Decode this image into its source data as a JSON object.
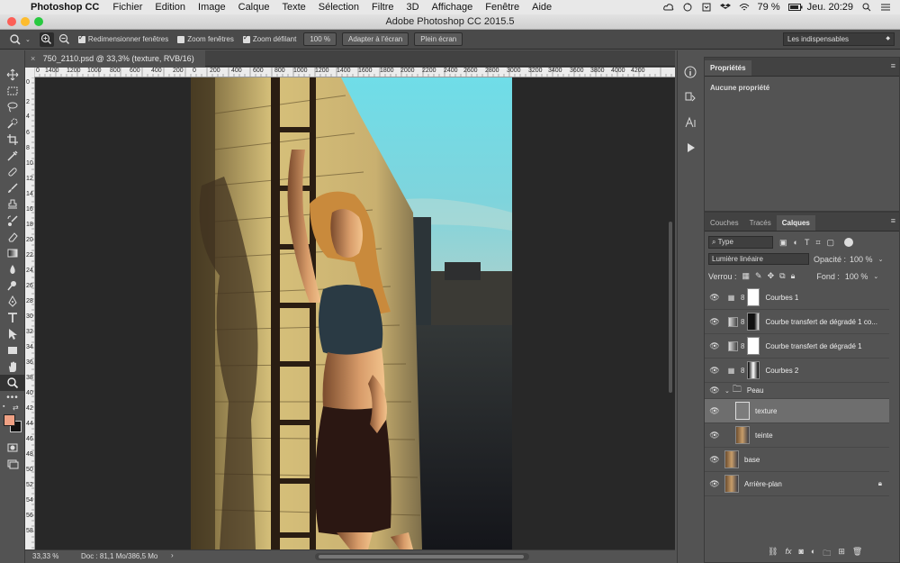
{
  "menubar": {
    "app": "Photoshop CC",
    "items": [
      "Fichier",
      "Edition",
      "Image",
      "Calque",
      "Texte",
      "Sélection",
      "Filtre",
      "3D",
      "Affichage",
      "Fenêtre",
      "Aide"
    ],
    "battery": "79 %",
    "clock": "Jeu. 20:29"
  },
  "window": {
    "title": "Adobe Photoshop CC 2015.5"
  },
  "options": {
    "resize_windows": "Redimensionner fenêtres",
    "zoom_windows": "Zoom fenêtres",
    "scrubby_zoom": "Zoom défilant",
    "zoom_value": "100 %",
    "fit_screen": "Adapter à l'écran",
    "full_screen": "Plein écran",
    "workspace": "Les indispensables"
  },
  "document": {
    "tab_title": "750_2110.psd @ 33,3% (texture, RVB/16)",
    "h_ruler": [
      "0",
      "1400",
      "1200",
      "1000",
      "800",
      "600",
      "400",
      "200",
      "0",
      "200",
      "400",
      "600",
      "800",
      "1000",
      "1200",
      "1400",
      "1600",
      "1800",
      "2000",
      "2200",
      "2400",
      "2600",
      "2800",
      "3000",
      "3200",
      "3400",
      "3600",
      "3800",
      "4000",
      "4200"
    ],
    "v_ruler": [
      "0",
      "2",
      "4",
      "6",
      "8",
      "10",
      "12",
      "14",
      "16",
      "18",
      "20",
      "22",
      "24",
      "26",
      "28",
      "30",
      "32",
      "34",
      "36",
      "38",
      "40",
      "42",
      "44",
      "46",
      "48",
      "50",
      "52",
      "54",
      "56",
      "58"
    ]
  },
  "status": {
    "zoom": "33,33 %",
    "doc": "Doc : 81,1 Mo/386,5 Mo"
  },
  "properties": {
    "tab": "Propriétés",
    "empty": "Aucune propriété"
  },
  "layers": {
    "tabs": [
      "Couches",
      "Tracés",
      "Calques"
    ],
    "filter": "Type",
    "blend_mode": "Lumière linéaire",
    "opacity_label": "Opacité :",
    "opacity": "100 %",
    "lock_label": "Verrou :",
    "fill_label": "Fond :",
    "fill": "100 %",
    "items": [
      {
        "name": "Courbes 1"
      },
      {
        "name": "Courbe transfert de dégradé 1 co..."
      },
      {
        "name": "Courbe transfert de dégradé 1"
      },
      {
        "name": "Courbes 2"
      },
      {
        "name": "Peau"
      },
      {
        "name": "texture"
      },
      {
        "name": "teinte"
      },
      {
        "name": "base"
      },
      {
        "name": "Arrière-plan"
      }
    ]
  },
  "colors": {
    "foreground": "#f0a184",
    "background": "#111111"
  }
}
